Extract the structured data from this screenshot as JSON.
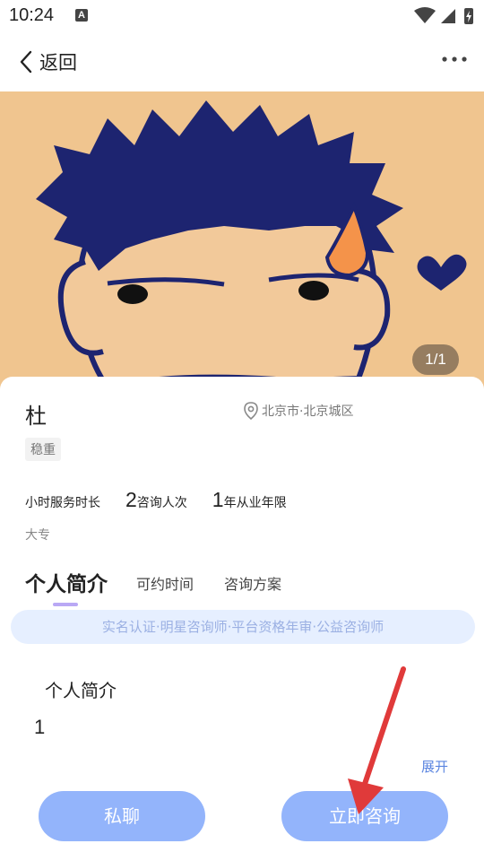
{
  "status_bar": {
    "time": "10:24",
    "notification_letter": "A"
  },
  "nav": {
    "back_label": "返回",
    "more_icon": "more-horizontal-icon"
  },
  "hero": {
    "counter": "1/1",
    "description_colors": {
      "background": "#f0c58f"
    }
  },
  "profile": {
    "name": "杜",
    "location": "北京市·北京城区",
    "tag": "稳重",
    "stats": [
      {
        "num": "",
        "label": "小时服务时长"
      },
      {
        "num": "2",
        "label": "咨询人次"
      },
      {
        "num": "1",
        "label": "年从业年限"
      }
    ],
    "education": "大专"
  },
  "tabs": [
    {
      "label": "个人简介",
      "active": true
    },
    {
      "label": "可约时间",
      "active": false
    },
    {
      "label": "咨询方案",
      "active": false
    }
  ],
  "certifications": "实名认证·明星咨询师·平台资格年审·公益咨询师",
  "intro": {
    "title": "个人简介",
    "body": "1",
    "expand_label": "展开"
  },
  "actions": {
    "chat_label": "私聊",
    "consult_label": "立即咨询"
  },
  "colors": {
    "accent": "#93b4fb",
    "tab_underline": "#b9a8f5",
    "link": "#5b85e0",
    "annotation_arrow": "#e03a3a"
  }
}
